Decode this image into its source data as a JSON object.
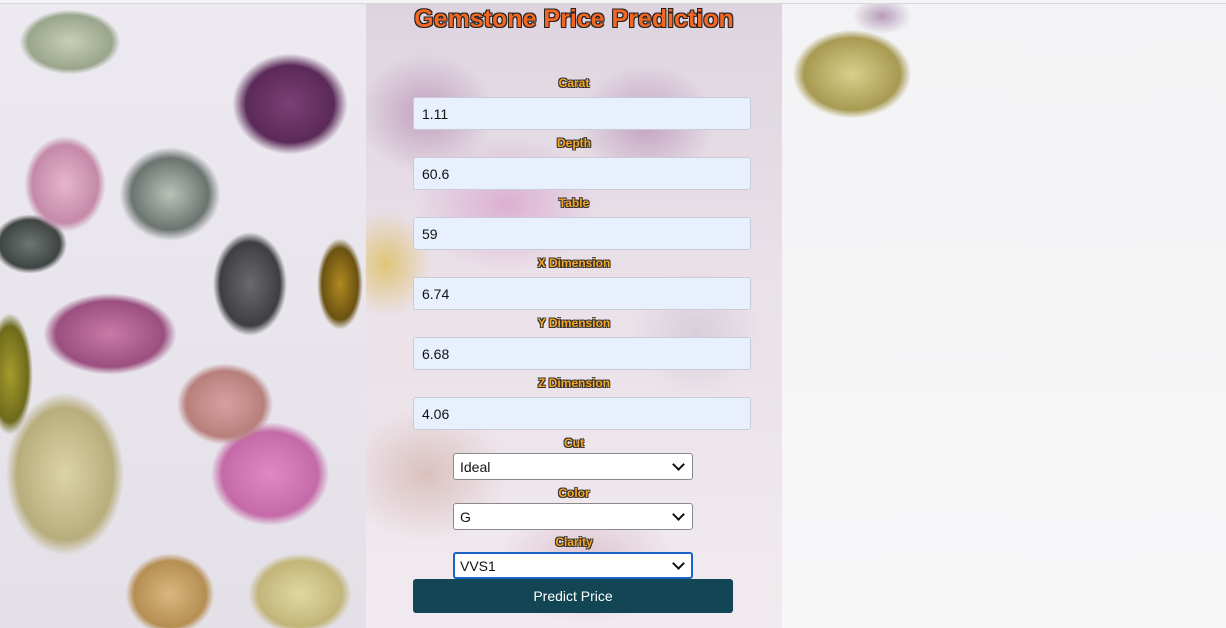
{
  "app": {
    "title": "Gemstone Price Prediction"
  },
  "form": {
    "fields": [
      {
        "label": "Carat",
        "value": "1.11"
      },
      {
        "label": "Depth",
        "value": "60.6"
      },
      {
        "label": "Table",
        "value": "59"
      },
      {
        "label": "X Dimension",
        "value": "6.74"
      },
      {
        "label": "Y Dimension",
        "value": "6.68"
      },
      {
        "label": "Z Dimension",
        "value": "4.06"
      }
    ],
    "selects": [
      {
        "label": "Cut",
        "value": "Ideal"
      },
      {
        "label": "Color",
        "value": "G"
      },
      {
        "label": "Clarity",
        "value": "VVS1",
        "focused": true
      }
    ],
    "submit_label": "Predict Price"
  },
  "colors": {
    "title": "#f26722",
    "label": "#f5a623",
    "input_bg": "#e8f0fe",
    "button_bg": "#124655",
    "focus_ring": "#1a64c8"
  },
  "icons": {
    "select_arrow": "chevron-down-icon"
  }
}
